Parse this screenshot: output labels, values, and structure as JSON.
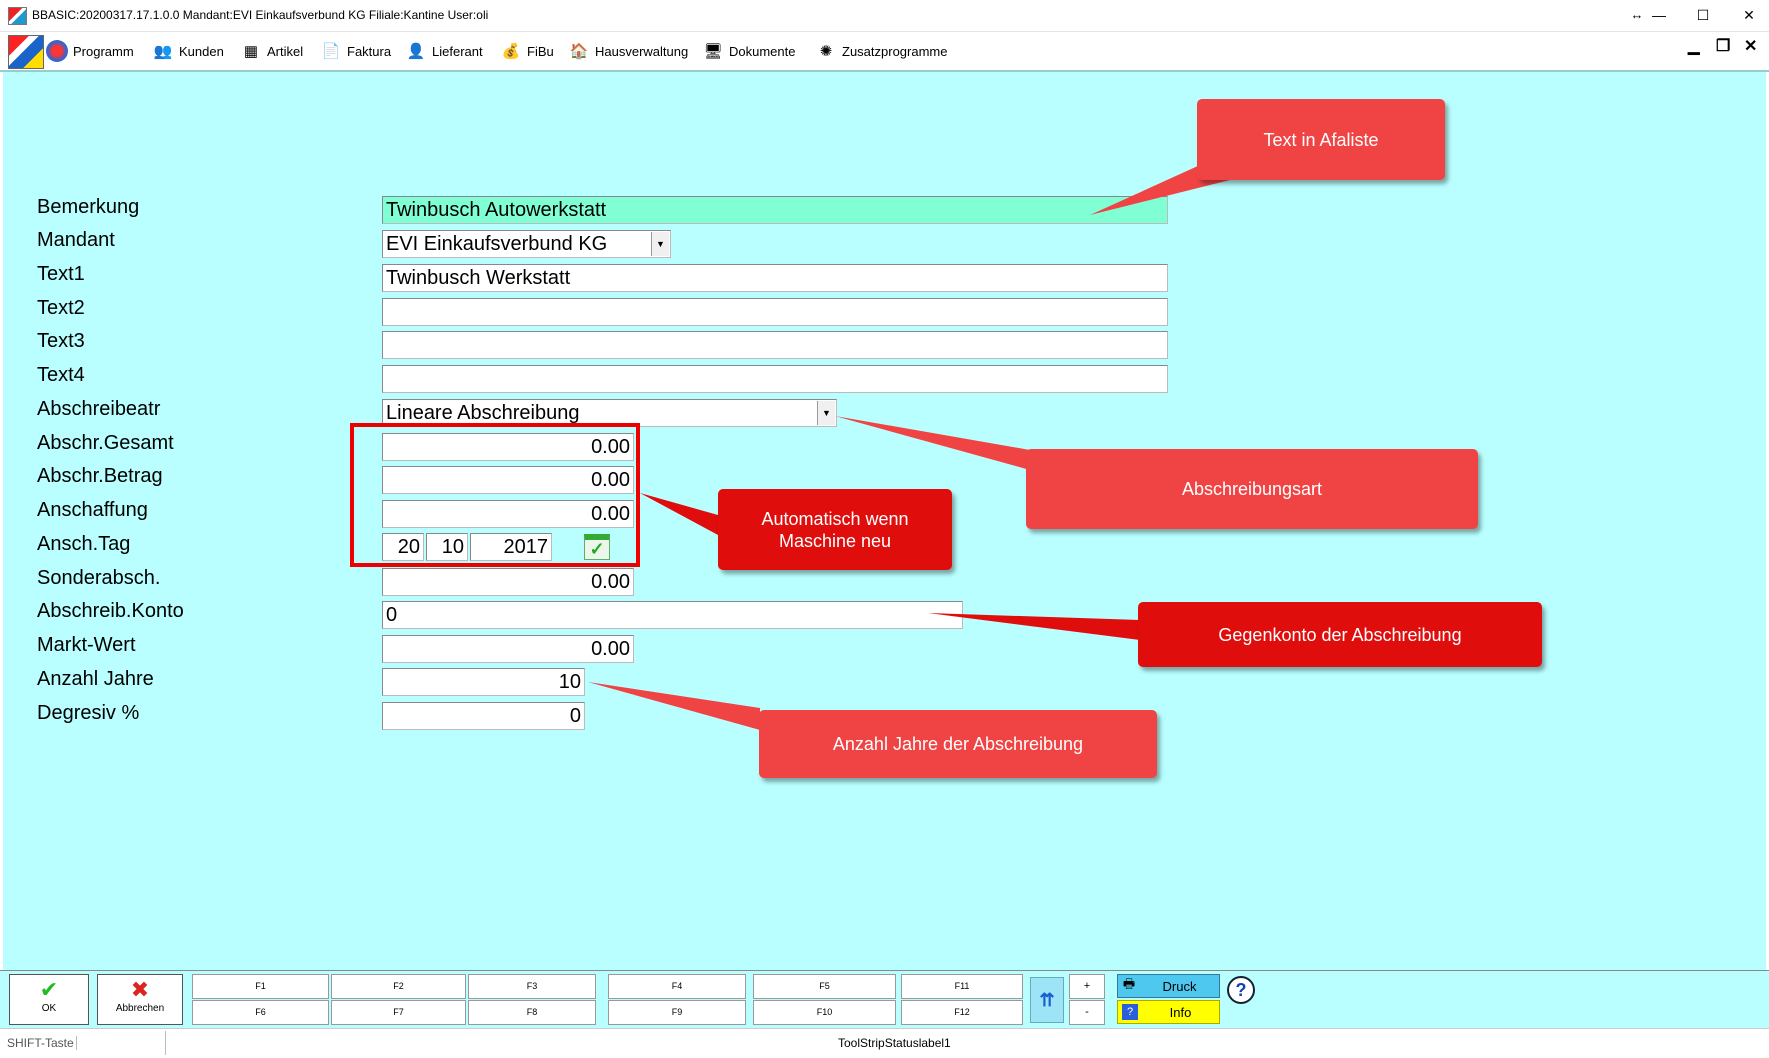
{
  "window": {
    "title": "BBASIC:20200317.17.1.0.0 Mandant:EVI Einkaufsverbund KG Filiale:Kantine User:oli",
    "controls": {
      "resize": "↔",
      "minimize": "—",
      "maximize": "☐",
      "close": "✕"
    }
  },
  "menu": {
    "items": [
      {
        "label": "Programm",
        "icon": "programm-icon"
      },
      {
        "label": "Kunden",
        "icon": "kunden-icon"
      },
      {
        "label": "Artikel",
        "icon": "artikel-icon"
      },
      {
        "label": "Faktura",
        "icon": "faktura-icon"
      },
      {
        "label": "Lieferant",
        "icon": "lieferant-icon"
      },
      {
        "label": "FiBu",
        "icon": "fibu-icon"
      },
      {
        "label": "Hausverwaltung",
        "icon": "hausverwaltung-icon"
      },
      {
        "label": "Dokumente",
        "icon": "dokumente-icon"
      },
      {
        "label": "Zusatzprogramme",
        "icon": "zusatzprogramme-icon"
      }
    ],
    "mdi": {
      "minimize": "▁",
      "restore": "❐",
      "close": "✕"
    }
  },
  "form": {
    "labels": {
      "bemerkung": "Bemerkung",
      "mandant": "Mandant",
      "text1": "Text1",
      "text2": "Text2",
      "text3": "Text3",
      "text4": "Text4",
      "abschreibeart": "Abschreibeatr",
      "abschr_gesamt": "Abschr.Gesamt",
      "abschr_betrag": "Abschr.Betrag",
      "anschaffung": "Anschaffung",
      "ansch_tag": "Ansch.Tag",
      "sonderabsch": "Sonderabsch.",
      "abschreib_konto": "Abschreib.Konto",
      "markt_wert": "Markt-Wert",
      "anzahl_jahre": "Anzahl Jahre",
      "degresiv": "Degresiv %"
    },
    "values": {
      "bemerkung": "Twinbusch Autowerkstatt",
      "mandant": "EVI Einkaufsverbund KG",
      "text1": "Twinbusch Werkstatt",
      "text2": "",
      "text3": "",
      "text4": "",
      "abschreibeart": "Lineare Abschreibung",
      "abschr_gesamt": "0.00",
      "abschr_betrag": "0.00",
      "anschaffung": "0.00",
      "ansch_tag_day": "20",
      "ansch_tag_month": "10",
      "ansch_tag_year": "2017",
      "sonderabsch": "0.00",
      "abschreib_konto": "0",
      "markt_wert": "0.00",
      "anzahl_jahre": "10",
      "degresiv": "0"
    }
  },
  "callouts": {
    "afaliste": "Text in Afaliste",
    "abschreibungsart": "Abschreibungsart",
    "automatisch": "Automatisch wenn Maschine neu",
    "gegenkonto": "Gegenkonto der Abschreibung",
    "anzahl_jahre": "Anzahl Jahre der Abschreibung"
  },
  "toolbar": {
    "ok": "OK",
    "abbrechen": "Abbrechen",
    "fkeys_top": [
      "F1",
      "F2",
      "F3",
      "F4",
      "F5",
      "F11"
    ],
    "fkeys_bottom": [
      "F6",
      "F7",
      "F8",
      "F9",
      "F10",
      "F12"
    ],
    "plus": "+",
    "minus": "-",
    "druck": "Druck",
    "info": "Info",
    "help": "?"
  },
  "statusbar": {
    "shift": "SHIFT-Taste",
    "label1": "ToolStripStatuslabel1"
  },
  "colors": {
    "background": "#b9ffff",
    "highlight_field": "#80ffd4",
    "callout": "#f04444",
    "callout_dark": "#e00d0d",
    "info_yellow": "#ffff00",
    "druck_blue": "#4fc8f0"
  }
}
